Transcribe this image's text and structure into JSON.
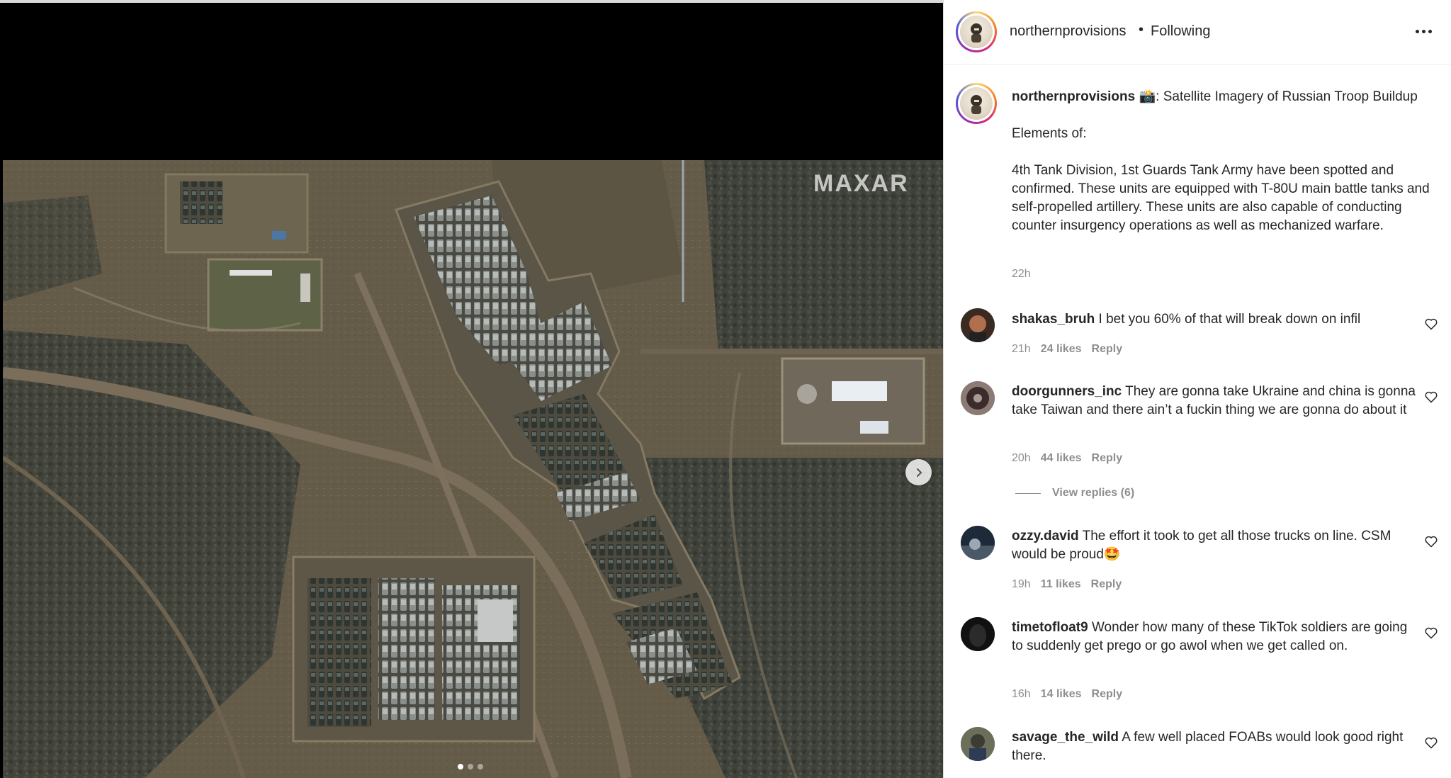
{
  "media": {
    "watermark": "MAXAR",
    "carousel": {
      "count": 3,
      "active_index": 0
    },
    "next_icon": "chevron-right-icon"
  },
  "header": {
    "username": "northernprovisions",
    "separator": "•",
    "follow_status": "Following",
    "more_icon": "more-horizontal-icon"
  },
  "caption": {
    "username": "northernprovisions",
    "emoji": "📸",
    "title": ": Satellite Imagery of Russian Troop Buildup",
    "line1": "Elements of:",
    "body": "4th Tank Division, 1st Guards Tank Army have been spotted and confirmed. These units are equipped with T-80U main battle tanks and self-propelled artillery. These units are also capable of conducting counter insurgency operations as well as mechanized warfare.",
    "time": "22h"
  },
  "comments": [
    {
      "username": "shakas_bruh",
      "text": "I bet you 60% of that will break down on infil",
      "time": "21h",
      "likes": "24 likes",
      "reply": "Reply"
    },
    {
      "username": "doorgunners_inc",
      "text": "They are gonna take Ukraine and china is gonna take Taiwan and there ain’t a fuckin thing we are gonna do about it",
      "time": "20h",
      "likes": "44 likes",
      "reply": "Reply"
    },
    {
      "username": "ozzy.david",
      "text": "The effort it took to get all those trucks on line. CSM would be proud🤩",
      "time": "19h",
      "likes": "11 likes",
      "reply": "Reply"
    },
    {
      "username": "timetofloat9",
      "text": "Wonder how many of these TikTok soldiers are going to suddenly get prego or go awol when we get called on.",
      "time": "16h",
      "likes": "14 likes",
      "reply": "Reply"
    },
    {
      "username": "savage_the_wild",
      "text": "A few well placed FOABs would look good right there."
    }
  ],
  "view_replies": "View replies (6)",
  "colors": {
    "text": "#262626",
    "muted": "#8e8e8e",
    "ground": "#5a5142",
    "forest": "#3f423b"
  }
}
